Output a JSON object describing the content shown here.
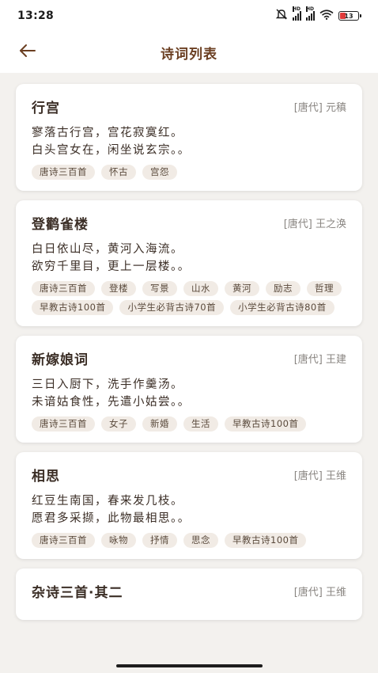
{
  "status_bar": {
    "time": "13:28",
    "battery": "13",
    "hd_label": "HD",
    "icons": [
      "mute-icon",
      "signal-icon",
      "signal-icon",
      "wifi-icon",
      "battery-icon"
    ]
  },
  "app_bar": {
    "title": "诗词列表",
    "back_icon": "arrow-left-icon"
  },
  "colors": {
    "accent": "#6b3f22",
    "tag_bg": "#f1ebe5",
    "background": "#f3f1ee"
  },
  "poems": [
    {
      "title": "行宫",
      "meta": "[唐代] 元稹",
      "lines": [
        "寥落古行宫，宫花寂寞红。",
        "白头宫女在，闲坐说玄宗。。"
      ],
      "tags": [
        "唐诗三百首",
        "怀古",
        "宫怨"
      ]
    },
    {
      "title": "登鹳雀楼",
      "meta": "[唐代] 王之涣",
      "lines": [
        "白日依山尽，黄河入海流。",
        "欲穷千里目，更上一层楼。。"
      ],
      "tags": [
        "唐诗三百首",
        "登楼",
        "写景",
        "山水",
        "黄河",
        "励志",
        "哲理",
        "早教古诗100首",
        "小学生必背古诗70首",
        "小学生必背古诗80首"
      ]
    },
    {
      "title": "新嫁娘词",
      "meta": "[唐代] 王建",
      "lines": [
        "三日入厨下，洗手作羹汤。",
        "未谙姑食性，先遣小姑尝。。"
      ],
      "tags": [
        "唐诗三百首",
        "女子",
        "新婚",
        "生活",
        "早教古诗100首"
      ]
    },
    {
      "title": "相思",
      "meta": "[唐代] 王维",
      "lines": [
        "红豆生南国，春来发几枝。",
        "愿君多采撷，此物最相思。。"
      ],
      "tags": [
        "唐诗三百首",
        "咏物",
        "抒情",
        "思念",
        "早教古诗100首"
      ]
    },
    {
      "title": "杂诗三首·其二",
      "meta": "[唐代] 王维",
      "lines": [],
      "tags": []
    }
  ]
}
